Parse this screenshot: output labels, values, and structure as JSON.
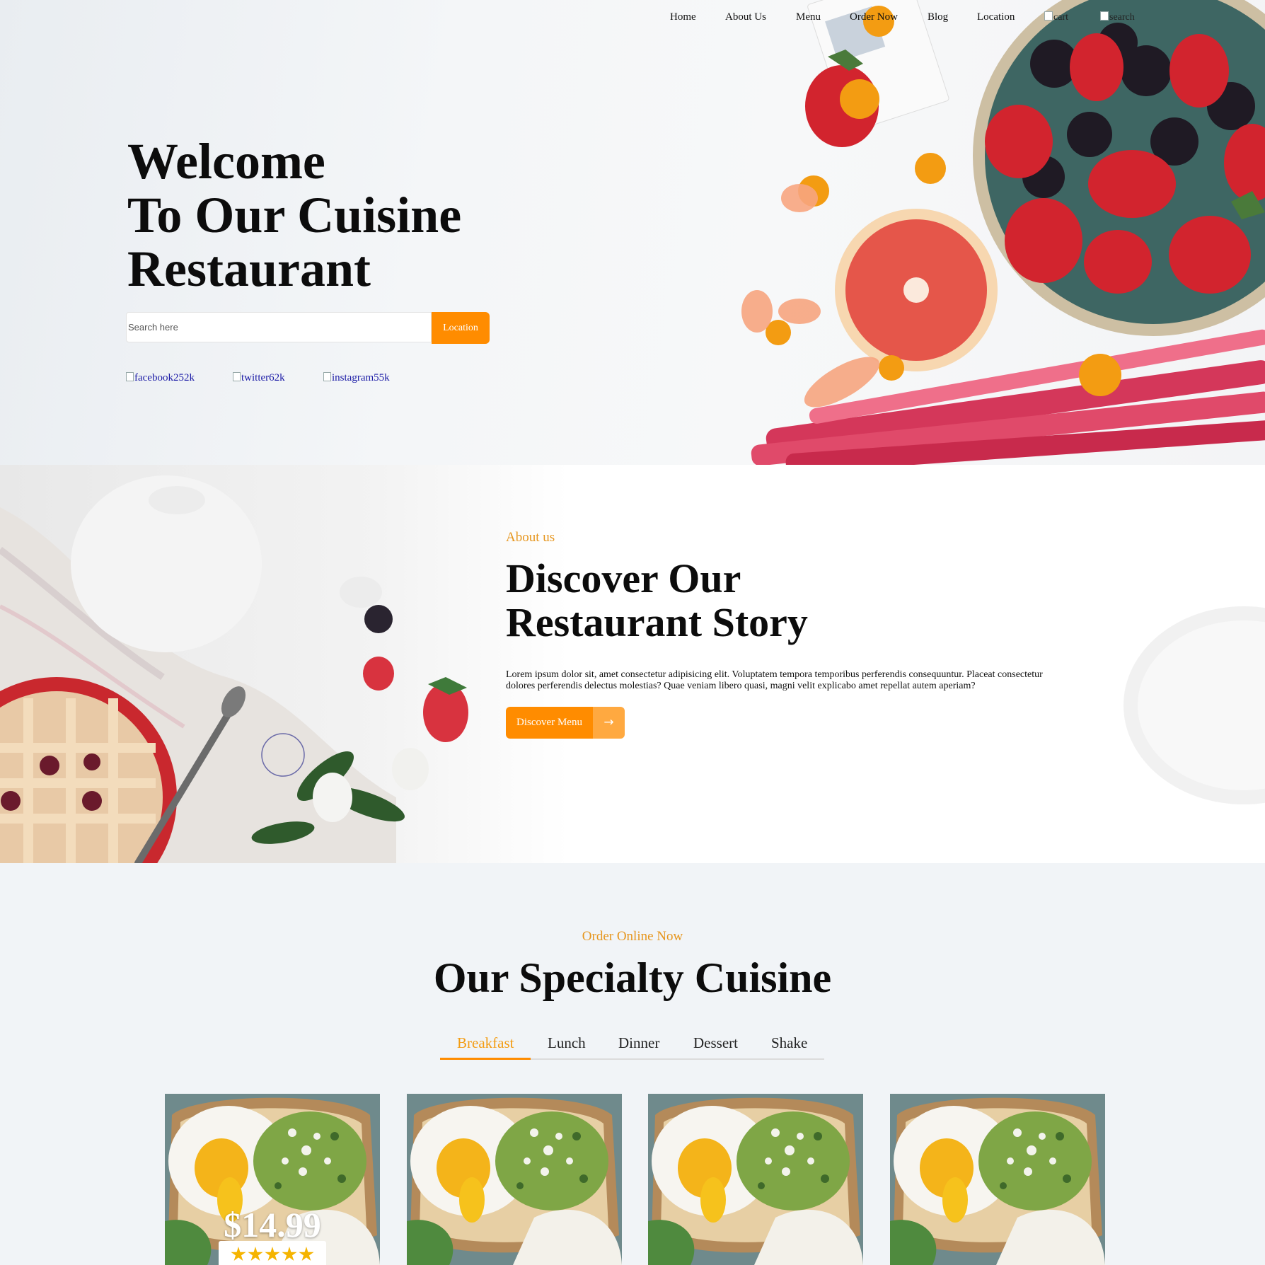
{
  "nav": {
    "items": [
      "Home",
      "About Us",
      "Menu",
      "Order Now",
      "Blog",
      "Location"
    ],
    "cart_alt": "cart",
    "search_alt": "search"
  },
  "hero": {
    "title_lines": [
      "Welcome",
      "To Our Cuisine",
      "Restaurant"
    ],
    "search_placeholder": "Search here",
    "location_button": "Location",
    "socials": [
      "facebook252k",
      "twitter62k",
      "instagram55k"
    ]
  },
  "about": {
    "eyebrow": "About us",
    "title_lines": [
      "Discover Our",
      "Restaurant Story"
    ],
    "text": "Lorem ipsum dolor sit, amet consectetur adipisicing elit. Voluptatem tempora temporibus perferendis consequuntur. Placeat consectetur dolores perferendis delectus molestias? Quae veniam libero quasi, magni velit explicabo amet repellat autem aperiam?",
    "button_label": "Discover Menu",
    "button_arrow": "→"
  },
  "specialty": {
    "eyebrow": "Order Online Now",
    "title": "Our Specialty Cuisine",
    "tabs": [
      "Breakfast",
      "Lunch",
      "Dinner",
      "Dessert",
      "Shake"
    ],
    "active_tab": "Breakfast",
    "cards": [
      {
        "price": "$14.99",
        "rating": 5
      },
      {
        "price": "",
        "rating": null
      },
      {
        "price": "",
        "rating": null
      },
      {
        "price": "",
        "rating": null
      }
    ]
  },
  "colors": {
    "accent": "#ff8c00",
    "accent_light": "#ffa940",
    "eyebrow": "#e6961e",
    "page_bg": "#f1f4f7"
  }
}
